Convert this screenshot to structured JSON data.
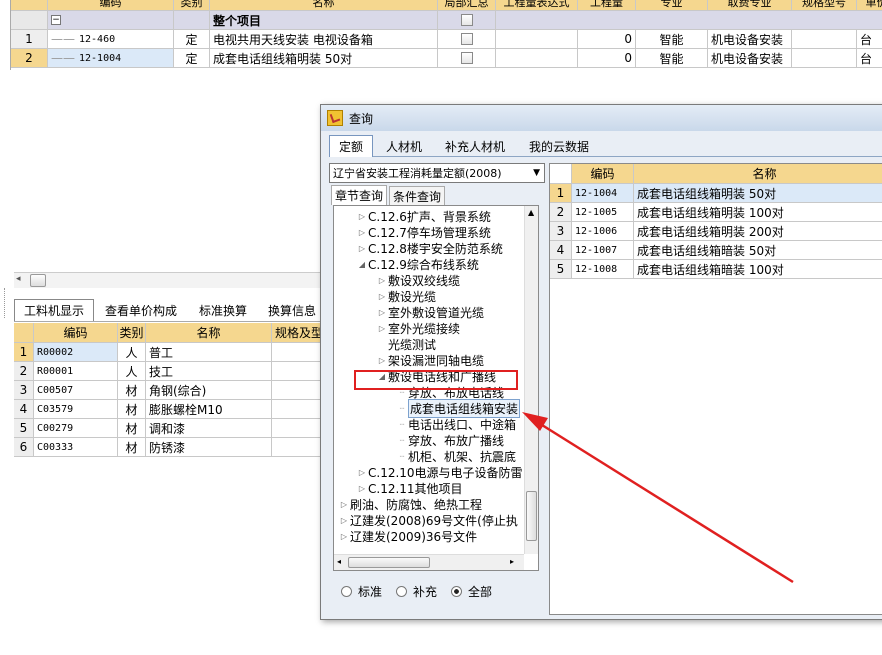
{
  "main": {
    "columns": [
      "编码",
      "类别",
      "名称",
      "局部汇总",
      "工程量表达式",
      "工程量",
      "专业",
      "取费专业",
      "规格型号",
      "单价"
    ],
    "group_title": "整个项目",
    "rows": [
      {
        "idx": "1",
        "code": "12-460",
        "type": "定",
        "name": "电视共用天线安装 电视设备箱",
        "qty": "0",
        "major": "智能",
        "fee": "机电设备安装",
        "unit": "台"
      },
      {
        "idx": "2",
        "code": "12-1004",
        "type": "定",
        "name": "成套电话组线箱明装 50对",
        "qty": "0",
        "major": "智能",
        "fee": "机电设备安装",
        "unit": "台"
      }
    ]
  },
  "bottom": {
    "tabs": [
      "工料机显示",
      "查看单价构成",
      "标准换算",
      "换算信息"
    ],
    "columns": [
      "编码",
      "类别",
      "名称",
      "规格及型号"
    ],
    "rows": [
      {
        "idx": "1",
        "code": "R00002",
        "type": "人",
        "name": "普工"
      },
      {
        "idx": "2",
        "code": "R00001",
        "type": "人",
        "name": "技工"
      },
      {
        "idx": "3",
        "code": "C00507",
        "type": "材",
        "name": "角钢(综合)"
      },
      {
        "idx": "4",
        "code": "C03579",
        "type": "材",
        "name": "膨胀螺栓M10"
      },
      {
        "idx": "5",
        "code": "C00279",
        "type": "材",
        "name": "调和漆"
      },
      {
        "idx": "6",
        "code": "C00333",
        "type": "材",
        "name": "防锈漆"
      }
    ]
  },
  "dialog": {
    "title": "查询",
    "tabs": [
      "定额",
      "人材机",
      "补充人材机",
      "我的云数据"
    ],
    "library": "辽宁省安装工程消耗量定额(2008)",
    "subtabs": [
      "章节查询",
      "条件查询"
    ],
    "tree": [
      {
        "label": "C.12.6扩声、背景系统",
        "level": 1,
        "arrow": "▷"
      },
      {
        "label": "C.12.7停车场管理系统",
        "level": 1,
        "arrow": "▷"
      },
      {
        "label": "C.12.8楼宇安全防范系统",
        "level": 1,
        "arrow": "▷"
      },
      {
        "label": "C.12.9综合布线系统",
        "level": 1,
        "arrow": "◢"
      },
      {
        "label": "敷设双绞线缆",
        "level": 2,
        "arrow": "▷"
      },
      {
        "label": "敷设光缆",
        "level": 2,
        "arrow": "▷"
      },
      {
        "label": "室外敷设管道光缆",
        "level": 2,
        "arrow": "▷"
      },
      {
        "label": "室外光缆接续",
        "level": 2,
        "arrow": "▷"
      },
      {
        "label": "光缆测试",
        "level": 2,
        "arrow": ""
      },
      {
        "label": "架设漏泄同轴电缆",
        "level": 2,
        "arrow": "▷"
      },
      {
        "label": "敷设电话线和广播线",
        "level": 2,
        "arrow": "◢"
      },
      {
        "label": "穿放、布放电话线",
        "level": 3,
        "arrow": ""
      },
      {
        "label": "成套电话组线箱安装",
        "level": 3,
        "arrow": ""
      },
      {
        "label": "电话出线口、中途箱",
        "level": 3,
        "arrow": ""
      },
      {
        "label": "穿放、布放广播线",
        "level": 3,
        "arrow": ""
      },
      {
        "label": "机柜、机架、抗震底",
        "level": 3,
        "arrow": ""
      },
      {
        "label": "C.12.10电源与电子设备防雷",
        "level": 1,
        "arrow": "▷"
      },
      {
        "label": "C.12.11其他项目",
        "level": 1,
        "arrow": "▷"
      },
      {
        "label": "刷油、防腐蚀、绝热工程",
        "level": 0,
        "arrow": "▷"
      },
      {
        "label": "辽建发(2008)69号文件(停止执",
        "level": 0,
        "arrow": "▷"
      },
      {
        "label": "辽建发(2009)36号文件",
        "level": 0,
        "arrow": "▷"
      }
    ],
    "radios": [
      "标准",
      "补充",
      "全部"
    ],
    "result_columns": [
      "编码",
      "名称"
    ],
    "results": [
      {
        "idx": "1",
        "code": "12-1004",
        "name": "成套电话组线箱明装 50对"
      },
      {
        "idx": "2",
        "code": "12-1005",
        "name": "成套电话组线箱明装 100对"
      },
      {
        "idx": "3",
        "code": "12-1006",
        "name": "成套电话组线箱明装 200对"
      },
      {
        "idx": "4",
        "code": "12-1007",
        "name": "成套电话组线箱暗装 50对"
      },
      {
        "idx": "5",
        "code": "12-1008",
        "name": "成套电话组线箱暗装 100对"
      }
    ]
  },
  "colors": {
    "header": "#f5d78f",
    "selected": "#dbe9f8",
    "annotation": "#e02020"
  }
}
